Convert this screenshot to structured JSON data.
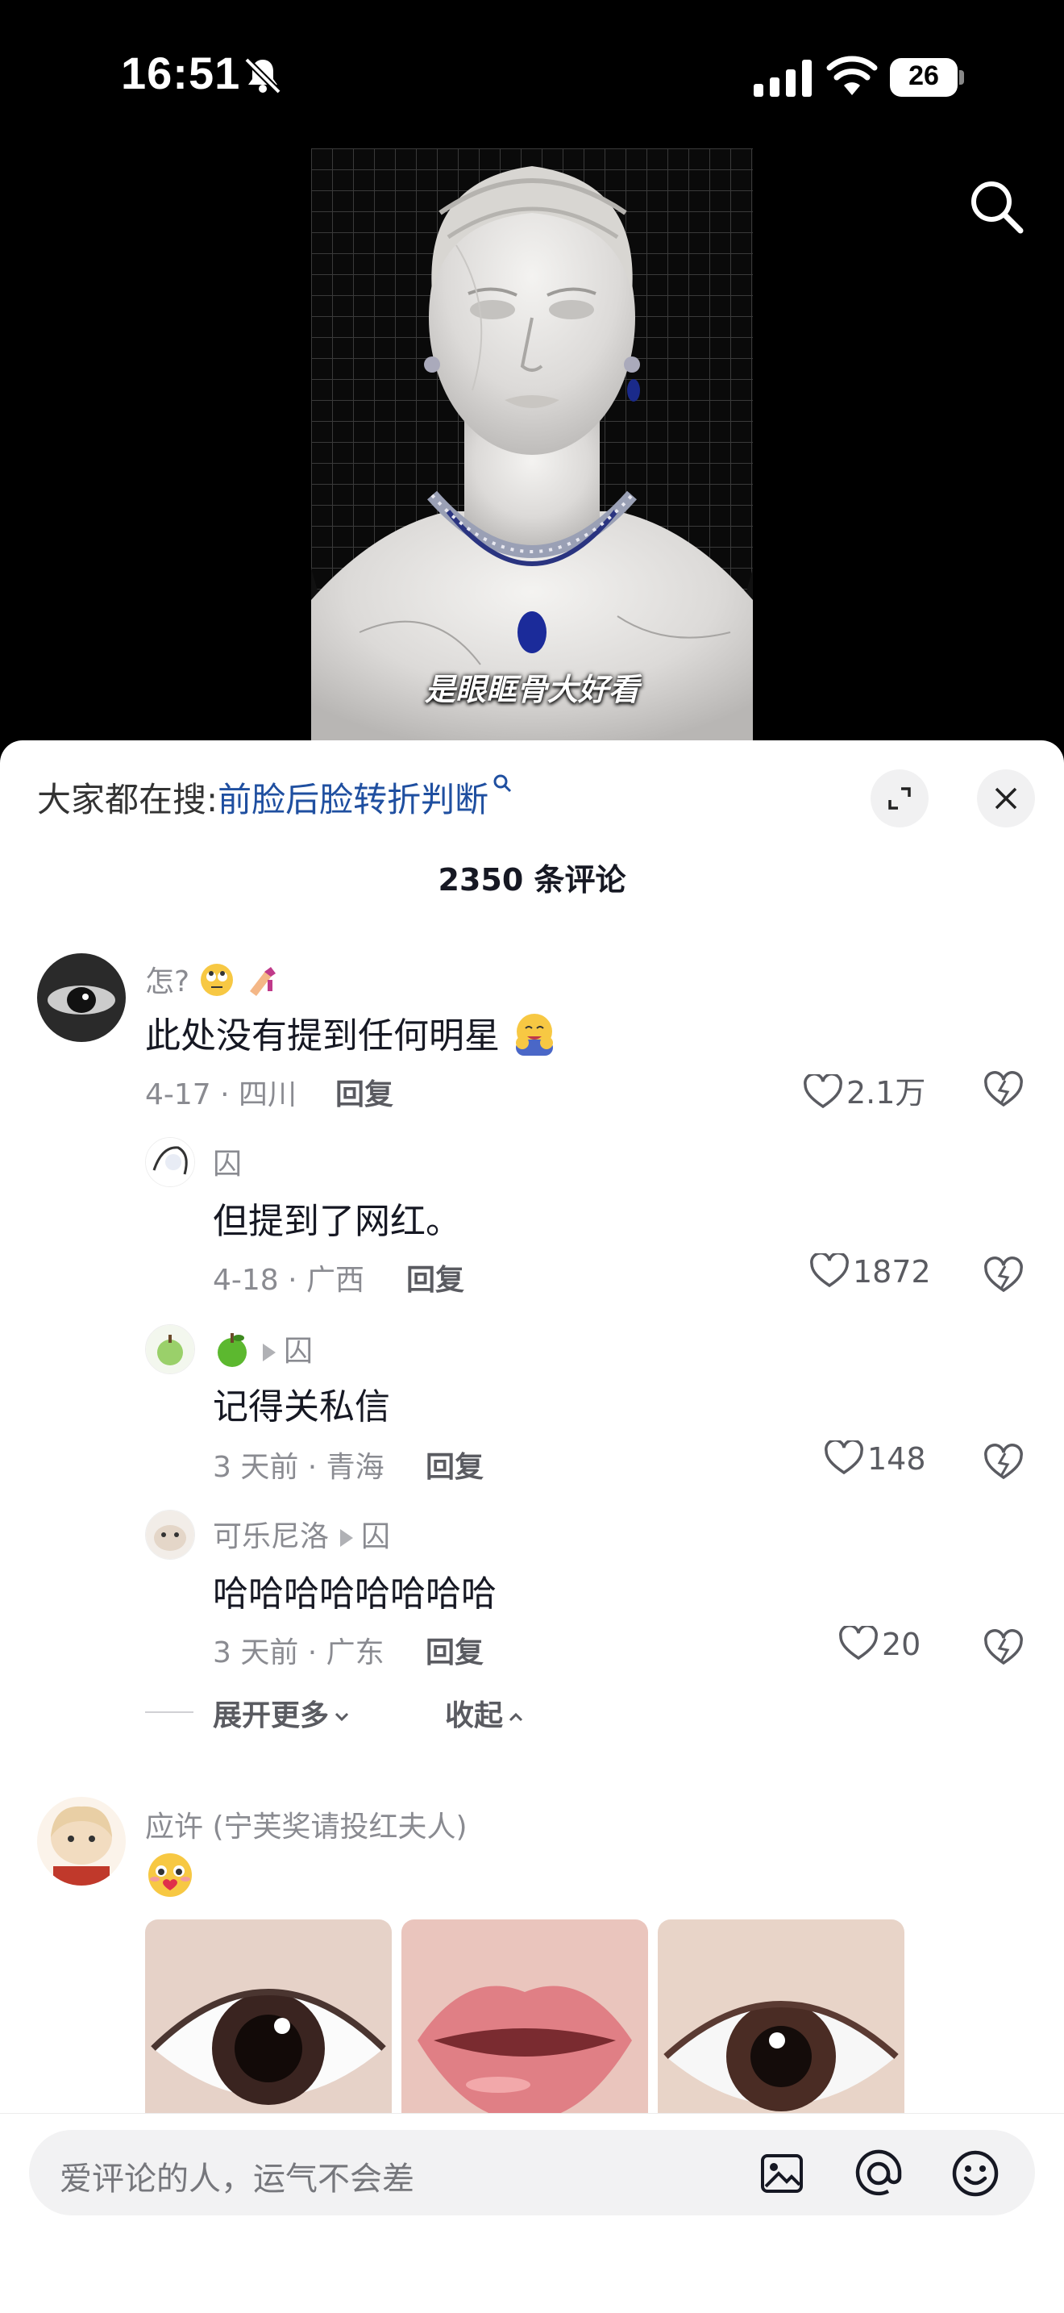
{
  "status_bar": {
    "time": "16:51",
    "battery": "26"
  },
  "video": {
    "caption": "是眼眶骨大好看"
  },
  "sheet": {
    "hot_search_label": "大家都在搜:",
    "hot_search_term": "前脸后脸转折判断",
    "comment_count": "2350 条评论"
  },
  "comments": [
    {
      "username": "怎?",
      "text": "此处没有提到任何明星",
      "date_location": "4-17 · 四川",
      "reply": "回复",
      "likes": "2.1万"
    },
    {
      "username": "囚",
      "text": "但提到了网红。",
      "date_location": "4-18 · 广西",
      "reply": "回复",
      "likes": "1872"
    },
    {
      "username_reply_to": "囚",
      "text": "记得关私信",
      "date_location": "3 天前 · 青海",
      "reply": "回复",
      "likes": "148"
    },
    {
      "username": "可乐尼洛",
      "username_reply_to": "囚",
      "text": "哈哈哈哈哈哈哈哈",
      "date_location": "3 天前 · 广东",
      "reply": "回复",
      "likes": "20"
    },
    {
      "username": "应许 (宁芙奖请投红夫人)"
    }
  ],
  "thread_controls": {
    "expand_more": "展开更多",
    "collapse": "收起"
  },
  "input_bar": {
    "placeholder": "爱评论的人，运气不会差"
  },
  "icons": [
    "bell-off-icon",
    "signal-icon",
    "wifi-icon",
    "battery-icon",
    "search-icon",
    "expand-icon",
    "close-icon",
    "heart-icon",
    "dislike-icon",
    "image-icon",
    "at-icon",
    "emoji-icon"
  ],
  "colors": {
    "hot_term": "#1f4fa0",
    "text": "#161823",
    "muted": "#8a8b91"
  }
}
